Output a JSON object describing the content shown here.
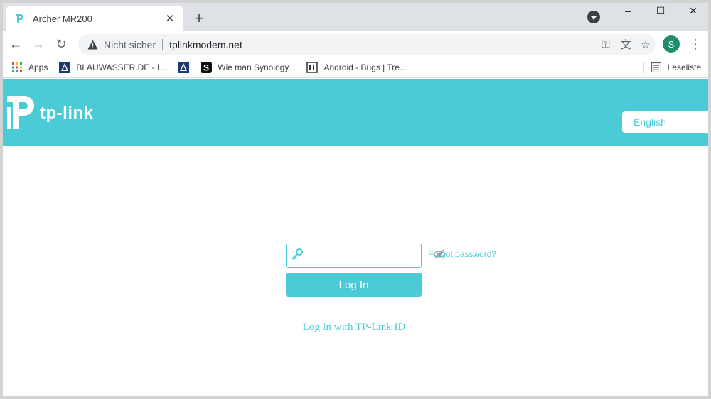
{
  "browser": {
    "tab": {
      "title": "Archer MR200",
      "favicon": "tp-link-favicon-icon",
      "close_glyph": "✕"
    },
    "new_tab_glyph": "+",
    "window_controls": {
      "minimize": "–",
      "maximize": "☐",
      "close": "✕"
    },
    "toolbar": {
      "back_glyph": "←",
      "forward_glyph": "→",
      "reload_glyph": "↻",
      "security_label": "Nicht sicher",
      "url": "tplinkmodem.net",
      "key_glyph": "⚿",
      "translate_glyph": "文",
      "star_glyph": "☆",
      "profile_initial": "S",
      "menu_glyph": "⋮"
    },
    "bookmarks": [
      {
        "label": "Apps",
        "icon": "apps-grid-icon"
      },
      {
        "label": "BLAUWASSER.DE - I...",
        "icon": "blauwasser-icon"
      },
      {
        "label": "",
        "icon": "blauwasser-icon"
      },
      {
        "label": "Wie man Synology...",
        "icon": "s-logo-icon"
      },
      {
        "label": "Android - Bugs | Tre...",
        "icon": "issue-tracker-icon"
      }
    ],
    "reading_list": "Leseliste"
  },
  "page": {
    "brand": "tp-link",
    "language": "English",
    "password_placeholder": "",
    "forgot_password": "Forgot password?",
    "login_button": "Log In",
    "tplink_id_link": "Log In with TP-Link ID"
  },
  "colors": {
    "accent": "#4acbd6",
    "tab_bar": "#dee1e6",
    "omnibox": "#f1f3f4",
    "profile": "#1e8e6e"
  }
}
